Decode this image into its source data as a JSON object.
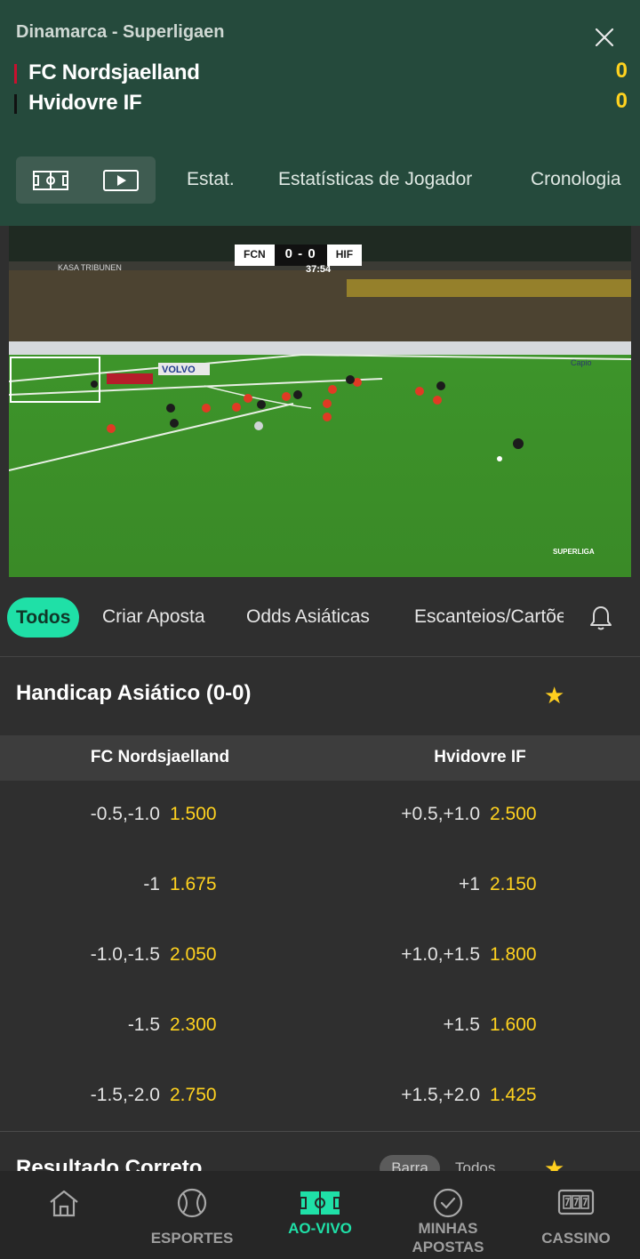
{
  "header": {
    "league": "Dinamarca - Superligaen",
    "team1": {
      "name": "FC Nordsjaelland",
      "score": "0",
      "color": "#c8102e"
    },
    "team2": {
      "name": "Hvidovre IF",
      "score": "0",
      "color": "#111111"
    },
    "tabs": [
      "Estat.",
      "Estatísticas de Jogador",
      "Cronologia"
    ]
  },
  "video": {
    "scorebug": {
      "home": "FCN",
      "score": "0 - 0",
      "away": "HIF",
      "time": "37:54"
    },
    "banners": [
      "VOLVO",
      "Capio",
      "SUPERLIGA",
      "KASA TRIBUNEN"
    ]
  },
  "market_tabs": {
    "active": "Todos",
    "items": [
      "Criar Aposta",
      "Odds Asiáticas",
      "Escanteios/Cartões"
    ]
  },
  "handicap": {
    "title": "Handicap Asiático (0-0)",
    "col1": "FC Nordsjaelland",
    "col2": "Hvidovre IF",
    "rows": [
      {
        "h1": "-0.5,-1.0",
        "p1": "1.500",
        "h2": "+0.5,+1.0",
        "p2": "2.500"
      },
      {
        "h1": "-1",
        "p1": "1.675",
        "h2": "+1",
        "p2": "2.150"
      },
      {
        "h1": "-1.0,-1.5",
        "p1": "2.050",
        "h2": "+1.0,+1.5",
        "p2": "1.800"
      },
      {
        "h1": "-1.5",
        "p1": "2.300",
        "h2": "+1.5",
        "p2": "1.600"
      },
      {
        "h1": "-1.5,-2.0",
        "p1": "2.750",
        "h2": "+1.5,+2.0",
        "p2": "1.425"
      }
    ]
  },
  "correct_score": {
    "title": "Resultado Correto",
    "pill_active": "Barra",
    "pill_other": "Todos"
  },
  "bottom_nav": {
    "home": "",
    "sports": "ESPORTES",
    "live": "AO-VIVO",
    "bets_line1": "MINHAS",
    "bets_line2": "APOSTAS",
    "casino": "CASSINO"
  },
  "colors": {
    "accent": "#1fe0a7",
    "odds": "#ffd21f",
    "header_bg": "#254a3c"
  }
}
